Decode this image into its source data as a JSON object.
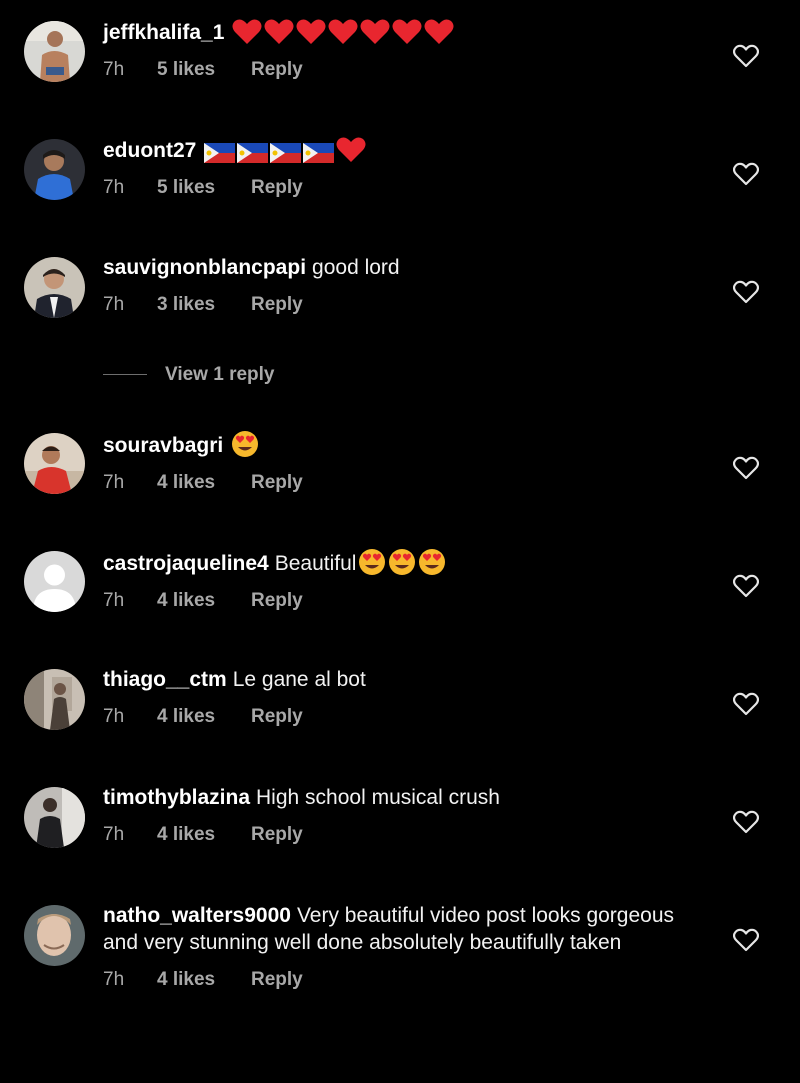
{
  "comments": [
    {
      "username": "jeffkhalifa_1",
      "text": "",
      "emoji": [
        "red-heart",
        "red-heart",
        "red-heart",
        "red-heart",
        "red-heart",
        "red-heart",
        "red-heart"
      ],
      "time": "7h",
      "likes": "5 likes",
      "reply": "Reply",
      "avatar": "photo-shirtless-man"
    },
    {
      "username": "eduont27",
      "text": "",
      "emoji": [
        "flag-philippines",
        "flag-philippines",
        "flag-philippines",
        "flag-philippines",
        "red-heart"
      ],
      "time": "7h",
      "likes": "5 likes",
      "reply": "Reply",
      "avatar": "photo-man-blue-shirt"
    },
    {
      "username": "sauvignonblancpapi",
      "text": "good lord",
      "emoji": [],
      "time": "7h",
      "likes": "3 likes",
      "reply": "Reply",
      "avatar": "photo-man-suit"
    },
    {
      "username": "souravbagri",
      "text": "",
      "emoji": [
        "heart-eyes-face"
      ],
      "time": "7h",
      "likes": "4 likes",
      "reply": "Reply",
      "avatar": "photo-man-red-shirt"
    },
    {
      "username": "castrojaqueline4",
      "text": "Beautiful",
      "emoji": [
        "heart-eyes-face",
        "heart-eyes-face",
        "heart-eyes-face"
      ],
      "time": "7h",
      "likes": "4 likes",
      "reply": "Reply",
      "avatar": "default-avatar"
    },
    {
      "username": "thiago__ctm",
      "text": "Le gane al bot",
      "emoji": [],
      "time": "7h",
      "likes": "4 likes",
      "reply": "Reply",
      "avatar": "photo-mirror-selfie"
    },
    {
      "username": "timothyblazina",
      "text": "High school musical crush",
      "emoji": [],
      "time": "7h",
      "likes": "4 likes",
      "reply": "Reply",
      "avatar": "photo-mirror-selfie-dark"
    },
    {
      "username": "natho_walters9000",
      "text": "Very beautiful video post looks gorgeous and very stunning well done absolutely beautifully taken",
      "emoji": [],
      "time": "7h",
      "likes": "4 likes",
      "reply": "Reply",
      "avatar": "photo-man-face"
    }
  ],
  "view_replies": {
    "label": "View 1 reply"
  },
  "colors": {
    "background": "#000000",
    "text": "#f5f5f5",
    "secondary": "#a8a8a8"
  }
}
